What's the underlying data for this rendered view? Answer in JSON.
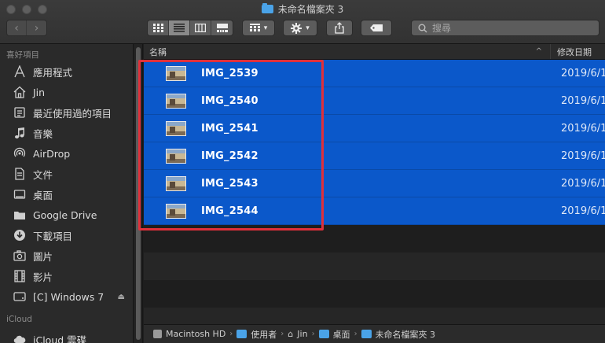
{
  "window": {
    "title": "未命名檔案夾 3"
  },
  "toolbar": {
    "back_glyph": "‹",
    "forward_glyph": "›",
    "search_placeholder": "搜尋"
  },
  "sidebar": {
    "favorites_header": "喜好項目",
    "favorites": [
      {
        "label": "應用程式",
        "icon": "applications-icon"
      },
      {
        "label": "Jin",
        "icon": "home-icon"
      },
      {
        "label": "最近使用過的項目",
        "icon": "recents-icon"
      },
      {
        "label": "音樂",
        "icon": "music-icon"
      },
      {
        "label": "AirDrop",
        "icon": "airdrop-icon"
      },
      {
        "label": "文件",
        "icon": "documents-icon"
      },
      {
        "label": "桌面",
        "icon": "desktop-icon"
      },
      {
        "label": "Google Drive",
        "icon": "folder-icon"
      },
      {
        "label": "下載項目",
        "icon": "downloads-icon"
      },
      {
        "label": "圖片",
        "icon": "pictures-icon"
      },
      {
        "label": "影片",
        "icon": "movies-icon"
      },
      {
        "label": "[C] Windows 7",
        "icon": "drive-icon"
      }
    ],
    "icloud_header": "iCloud",
    "icloud": [
      {
        "label": "iCloud 雲碟",
        "icon": "icloud-icon"
      }
    ]
  },
  "list": {
    "col_name": "名稱",
    "col_date": "修改日期",
    "files": [
      {
        "name": "IMG_2539",
        "date": "2019/6/1"
      },
      {
        "name": "IMG_2540",
        "date": "2019/6/1"
      },
      {
        "name": "IMG_2541",
        "date": "2019/6/1"
      },
      {
        "name": "IMG_2542",
        "date": "2019/6/1"
      },
      {
        "name": "IMG_2543",
        "date": "2019/6/1"
      },
      {
        "name": "IMG_2544",
        "date": "2019/6/1"
      }
    ]
  },
  "pathbar": {
    "items": [
      "Macintosh HD",
      "使用者",
      "Jin",
      "桌面",
      "未命名檔案夾 3"
    ]
  },
  "colors": {
    "selection": "#0b58ca",
    "highlight_box": "#e0303a",
    "folder": "#4aa3e8"
  }
}
